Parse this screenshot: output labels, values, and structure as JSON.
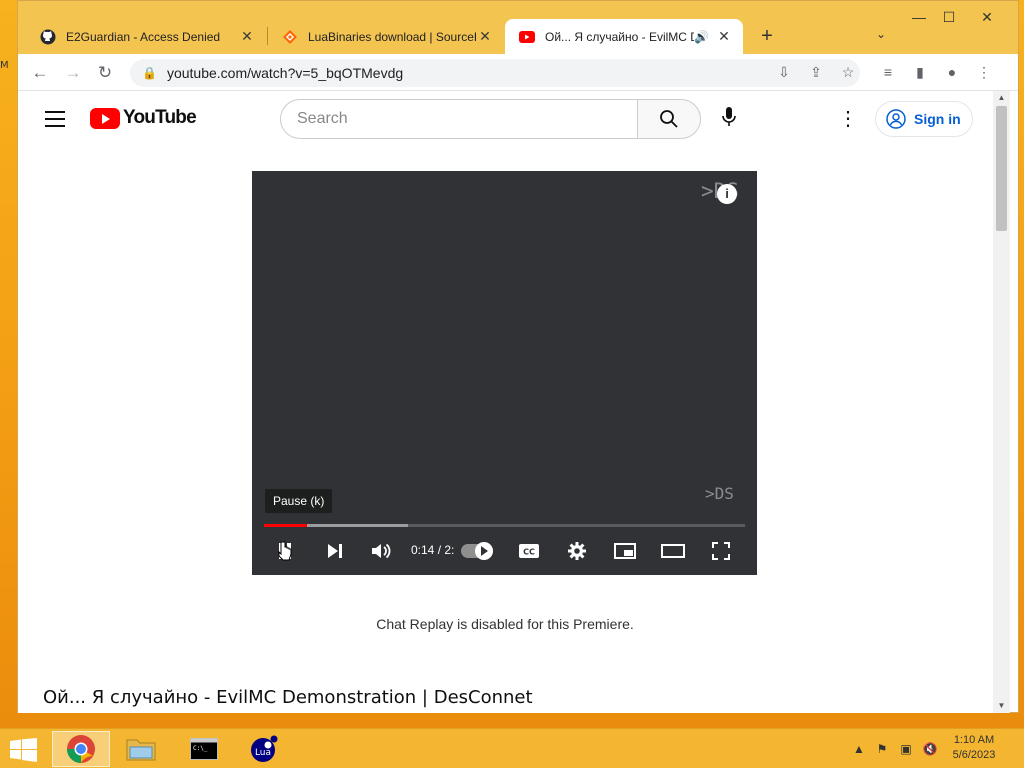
{
  "desktop": {
    "edge_glyph": "M"
  },
  "window": {
    "tabs": [
      {
        "title": "E2Guardian - Access Denied",
        "icon": "github-icon"
      },
      {
        "title": "LuaBinaries download | SourceForge",
        "icon": "sourceforge-icon"
      },
      {
        "title": "Ой... Я случайно - EvilMC Demonstration",
        "icon": "youtube-icon",
        "active": true
      }
    ],
    "new_tab": "+",
    "tab_search": "⌄",
    "controls": {
      "minimize": "—",
      "maximize": "☐",
      "close": "✕"
    }
  },
  "toolbar": {
    "url": "youtube.com/watch?v=5_bqOTMevdg"
  },
  "youtube": {
    "logo_text": "YouTube",
    "search_placeholder": "Search",
    "signin_label": "Sign in",
    "player": {
      "watermark_top": ">DS",
      "watermark_bottom": ">DS",
      "info_label": "i",
      "tooltip": "Pause (k)",
      "time": "0:14 / 2:",
      "progress_fraction": 0.09,
      "buffer_fraction": 0.3
    },
    "chat_note": "Chat Replay is disabled for this Premiere.",
    "video_title": "Ой... Я случайно - EvilMC Demonstration | DesConnet"
  },
  "taskbar": {
    "clock_time": "1:10 AM",
    "clock_date": "5/6/2023",
    "lua_label": "Lua"
  },
  "colors": {
    "accent": "#f4c451",
    "yt_red": "#ff0000",
    "link_blue": "#065fd4"
  }
}
